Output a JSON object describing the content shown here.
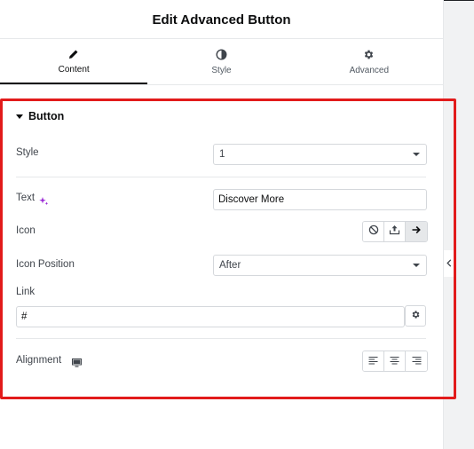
{
  "header": {
    "title": "Edit Advanced Button"
  },
  "tabs": [
    {
      "label": "Content",
      "icon": "pencil-icon",
      "active": true
    },
    {
      "label": "Style",
      "icon": "half-circle-icon",
      "active": false
    },
    {
      "label": "Advanced",
      "icon": "gear-icon",
      "active": false
    }
  ],
  "section": {
    "title": "Button"
  },
  "fields": {
    "style": {
      "label": "Style",
      "value": "1"
    },
    "text": {
      "label": "Text",
      "value": "Discover More"
    },
    "icon": {
      "label": "Icon",
      "options": [
        "none-icon",
        "upload-icon",
        "arrow-right-icon"
      ],
      "selected": "arrow-right-icon"
    },
    "icon_position": {
      "label": "Icon Position",
      "value": "After"
    },
    "link": {
      "label": "Link",
      "value": "#"
    },
    "alignment": {
      "label": "Alignment",
      "options": [
        "align-left-icon",
        "align-center-icon",
        "align-right-icon"
      ]
    }
  },
  "colors": {
    "highlight": "#e21b1b",
    "ai_accent": "#9b2bd6"
  }
}
